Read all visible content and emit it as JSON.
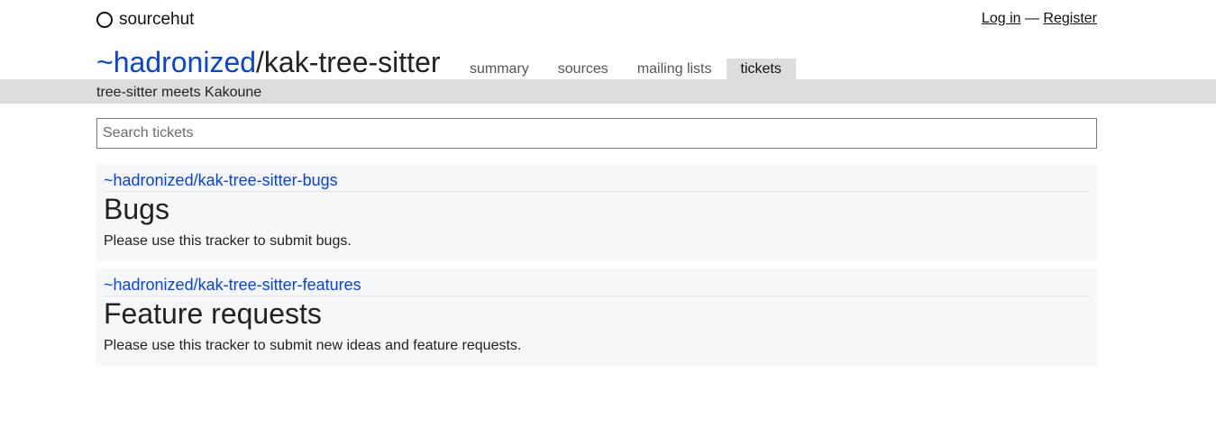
{
  "header": {
    "brand": "sourcehut",
    "login_label": "Log in",
    "separator": "—",
    "register_label": "Register"
  },
  "repo": {
    "owner": "~hadronized",
    "slash": "/",
    "name": "kak-tree-sitter",
    "description": "tree-sitter meets Kakoune"
  },
  "tabs": [
    {
      "label": "summary",
      "active": false
    },
    {
      "label": "sources",
      "active": false
    },
    {
      "label": "mailing lists",
      "active": false
    },
    {
      "label": "tickets",
      "active": true
    }
  ],
  "search": {
    "placeholder": "Search tickets",
    "value": ""
  },
  "trackers": [
    {
      "name": "~hadronized/kak-tree-sitter-bugs",
      "title": "Bugs",
      "description": "Please use this tracker to submit bugs."
    },
    {
      "name": "~hadronized/kak-tree-sitter-features",
      "title": "Feature requests",
      "description": "Please use this tracker to submit new ideas and feature requests."
    }
  ],
  "icons": {
    "brand_logo": "sourcehut-circle-icon"
  }
}
